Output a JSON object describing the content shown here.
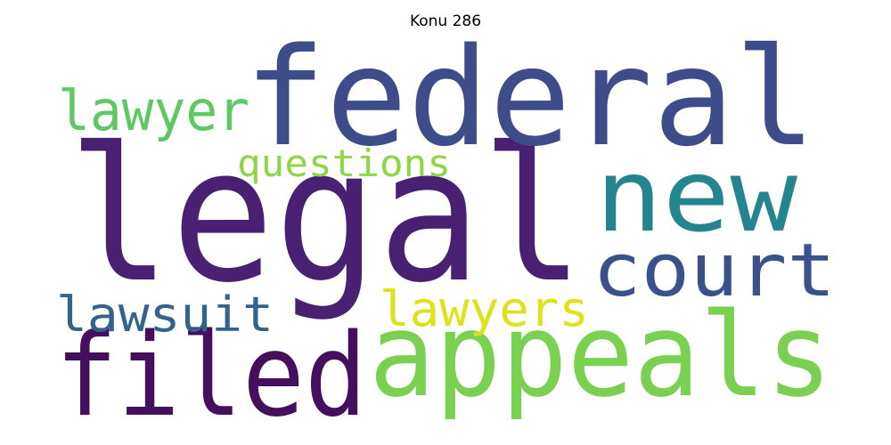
{
  "title": "Konu 286",
  "words": [
    {
      "text": "legal",
      "color": "#482173"
    },
    {
      "text": "federal",
      "color": "#3e4c8a"
    },
    {
      "text": "new",
      "color": "#25858e"
    },
    {
      "text": "appeals",
      "color": "#7ad151"
    },
    {
      "text": "filed",
      "color": "#440f5d"
    },
    {
      "text": "court",
      "color": "#3b518b"
    },
    {
      "text": "lawyer",
      "color": "#5ec962"
    },
    {
      "text": "lawsuit",
      "color": "#33638d"
    },
    {
      "text": "lawyers",
      "color": "#dde318"
    },
    {
      "text": "questions",
      "color": "#8ed645"
    }
  ]
}
